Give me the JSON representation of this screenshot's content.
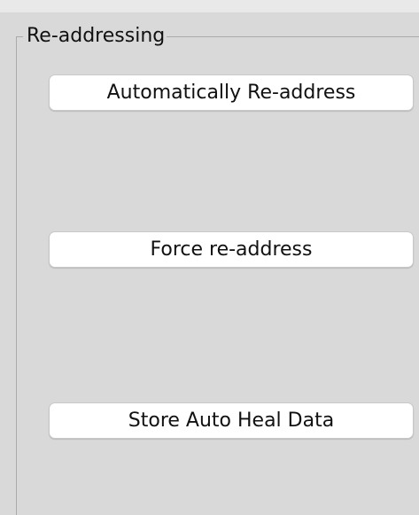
{
  "panel": {
    "title": "Re-addressing"
  },
  "buttons": {
    "auto_readdress": "Automatically Re-address",
    "force_readdress": "Force re-address",
    "store_auto_heal": "Store Auto Heal Data"
  }
}
